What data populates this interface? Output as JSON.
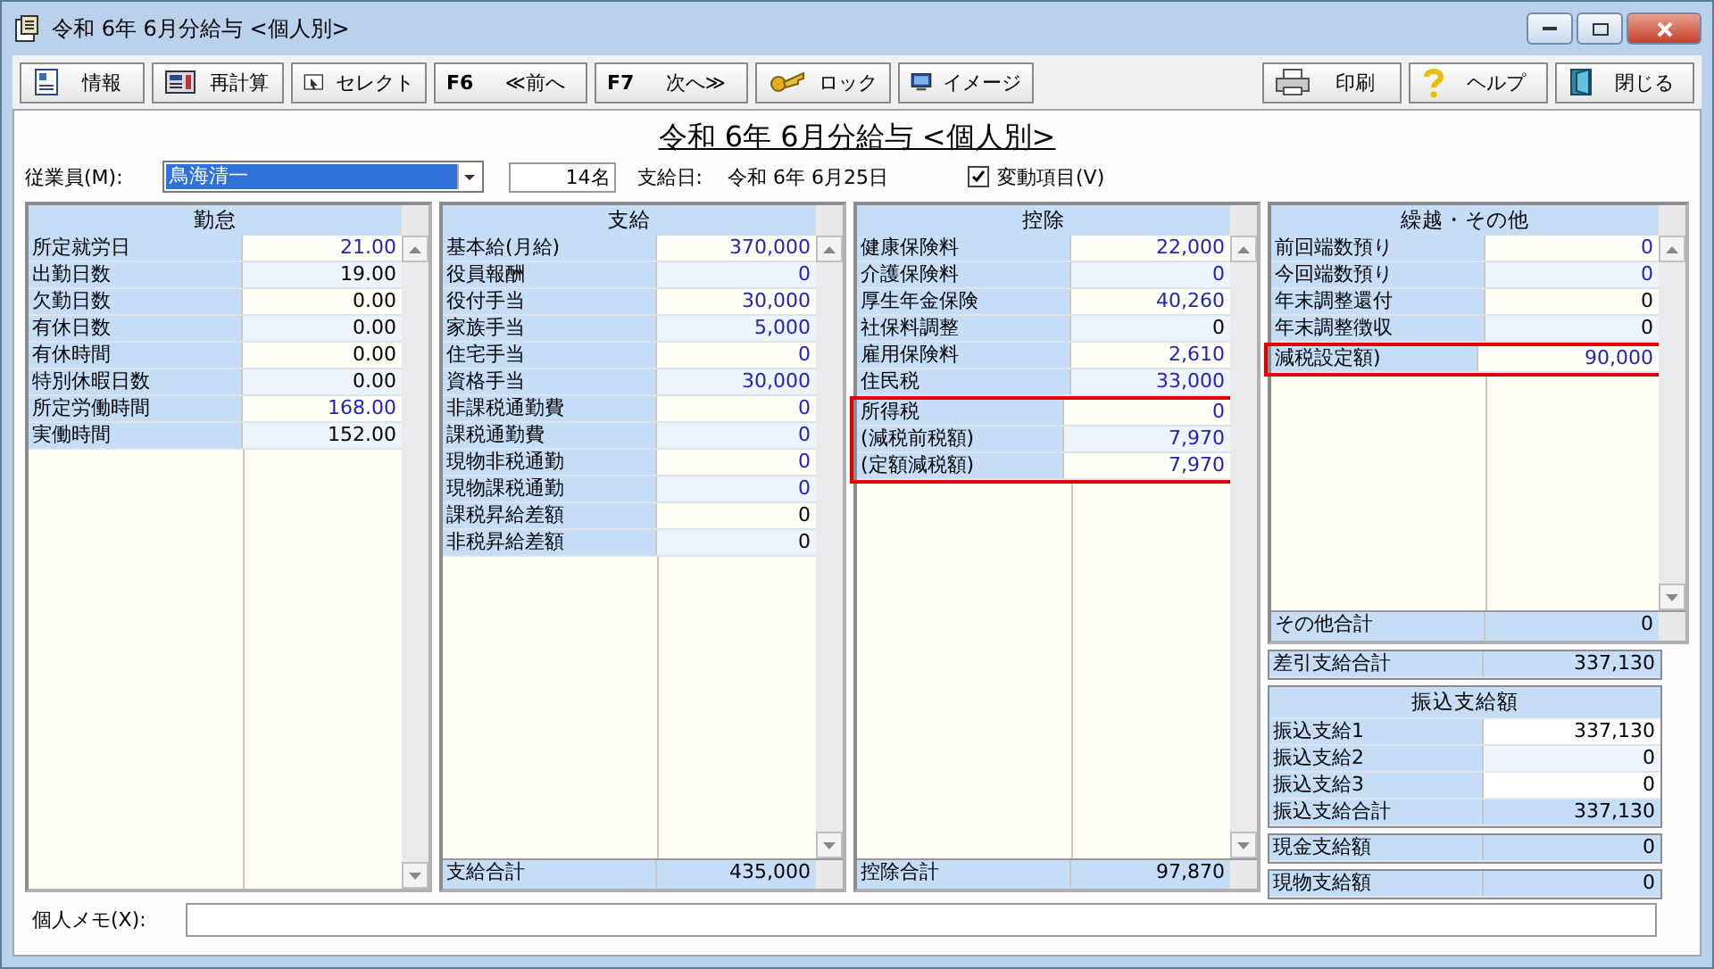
{
  "window": {
    "title": "令和 6年 6月分給与 <個人別>"
  },
  "toolbar": {
    "left": [
      {
        "kind": "info",
        "label": "情報"
      },
      {
        "kind": "calc",
        "label": "再計算"
      },
      {
        "kind": "select",
        "label": "セレクト"
      },
      {
        "kind": "key",
        "key": "F6",
        "label": "≪前へ"
      },
      {
        "kind": "key",
        "key": "F7",
        "label": "次へ≫"
      },
      {
        "kind": "lock",
        "label": "ロック"
      },
      {
        "kind": "image",
        "label": "イメージ"
      }
    ],
    "right": [
      {
        "kind": "print",
        "label": "印刷"
      },
      {
        "kind": "help",
        "label": "ヘルプ"
      },
      {
        "kind": "close",
        "label": "閉じる"
      }
    ]
  },
  "heading": "令和 6年 6月分給与 <個人別>",
  "employee": {
    "label": "従業員(M):",
    "value": "鳥海清一",
    "count": "14名",
    "pay_date_label": "支給日:",
    "pay_date": "令和 6年 6月25日",
    "variable_items": {
      "label": "変動項目(V)",
      "checked": true
    }
  },
  "panels": [
    {
      "title": "勤怠",
      "rows": [
        {
          "label": "所定就労日",
          "value": "21.00",
          "input": true,
          "highlighted": false
        },
        {
          "label": "出勤日数",
          "value": "19.00",
          "input": false,
          "highlighted": false
        },
        {
          "label": "欠勤日数",
          "value": "0.00",
          "input": false,
          "highlighted": false
        },
        {
          "label": "有休日数",
          "value": "0.00",
          "input": false,
          "highlighted": false
        },
        {
          "label": "有休時間",
          "value": "0.00",
          "input": false,
          "highlighted": false
        },
        {
          "label": "特別休暇日数",
          "value": "0.00",
          "input": false,
          "highlighted": false
        },
        {
          "label": "所定労働時間",
          "value": "168.00",
          "input": true,
          "highlighted": false
        },
        {
          "label": "実働時間",
          "value": "152.00",
          "input": false,
          "highlighted": false
        }
      ]
    },
    {
      "title": "支給",
      "rows": [
        {
          "label": "基本給(月給)",
          "value": "370,000",
          "input": true,
          "highlighted": false
        },
        {
          "label": "役員報酬",
          "value": "0",
          "input": true,
          "highlighted": false
        },
        {
          "label": "役付手当",
          "value": "30,000",
          "input": true,
          "highlighted": false
        },
        {
          "label": "家族手当",
          "value": "5,000",
          "input": true,
          "highlighted": false
        },
        {
          "label": "住宅手当",
          "value": "0",
          "input": true,
          "highlighted": false
        },
        {
          "label": "資格手当",
          "value": "30,000",
          "input": true,
          "highlighted": false
        },
        {
          "label": "非課税通勤費",
          "value": "0",
          "input": true,
          "highlighted": false
        },
        {
          "label": "課税通勤費",
          "value": "0",
          "input": true,
          "highlighted": false
        },
        {
          "label": "現物非税通勤",
          "value": "0",
          "input": true,
          "highlighted": false
        },
        {
          "label": "現物課税通勤",
          "value": "0",
          "input": true,
          "highlighted": false
        },
        {
          "label": "課税昇給差額",
          "value": "0",
          "input": false,
          "highlighted": false
        },
        {
          "label": "非税昇給差額",
          "value": "0",
          "input": false,
          "highlighted": false
        }
      ],
      "total": {
        "label": "支給合計",
        "value": "435,000"
      }
    },
    {
      "title": "控除",
      "rows": [
        {
          "label": "健康保険料",
          "value": "22,000",
          "input": true,
          "highlighted": false
        },
        {
          "label": "介護保険料",
          "value": "0",
          "input": true,
          "highlighted": false
        },
        {
          "label": "厚生年金保険",
          "value": "40,260",
          "input": true,
          "highlighted": false
        },
        {
          "label": "社保料調整",
          "value": "0",
          "input": false,
          "highlighted": false
        },
        {
          "label": "雇用保険料",
          "value": "2,610",
          "input": true,
          "highlighted": false
        },
        {
          "label": "住民税",
          "value": "33,000",
          "input": true,
          "highlighted": false
        },
        {
          "label": "所得税",
          "value": "0",
          "input": true,
          "highlighted": true
        },
        {
          "label": "(減税前税額)",
          "value": "7,970",
          "input": true,
          "highlighted": true
        },
        {
          "label": "(定額減税額)",
          "value": "7,970",
          "input": true,
          "highlighted": true
        }
      ],
      "total": {
        "label": "控除合計",
        "value": "97,870"
      }
    },
    {
      "title": "繰越・その他",
      "rows": [
        {
          "label": "前回端数預り",
          "value": "0",
          "input": true,
          "highlighted": false
        },
        {
          "label": "今回端数預り",
          "value": "0",
          "input": true,
          "highlighted": false
        },
        {
          "label": "年末調整還付",
          "value": "0",
          "input": false,
          "highlighted": false
        },
        {
          "label": "年末調整徴収",
          "value": "0",
          "input": false,
          "highlighted": false
        },
        {
          "label": "減税設定額)",
          "value": "90,000",
          "input": true,
          "highlighted": true
        }
      ],
      "total": {
        "label": "その他合計",
        "value": "0"
      }
    }
  ],
  "net_pay": {
    "label": "差引支給合計",
    "value": "337,130"
  },
  "transfer": {
    "title": "振込支給額",
    "rows": [
      {
        "label": "振込支給1",
        "value": "337,130"
      },
      {
        "label": "振込支給2",
        "value": "0"
      },
      {
        "label": "振込支給3",
        "value": "0"
      }
    ],
    "total": {
      "label": "振込支給合計",
      "value": "337,130"
    }
  },
  "other_amounts": [
    {
      "label": "現金支給額",
      "value": "0"
    },
    {
      "label": "現物支給額",
      "value": "0"
    }
  ],
  "memo": {
    "label": "個人メモ(X):"
  }
}
